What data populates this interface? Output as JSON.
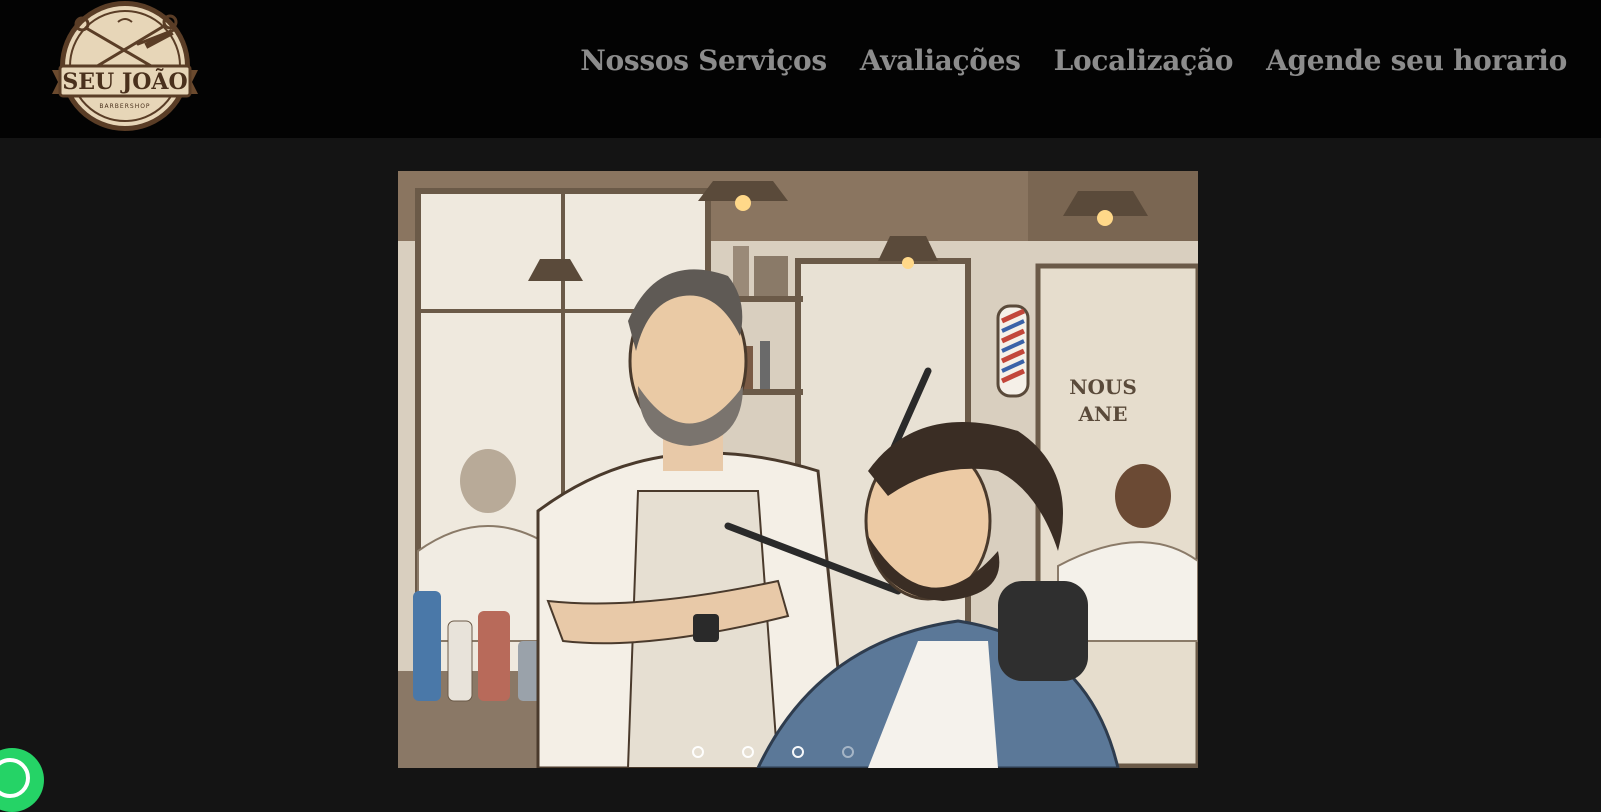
{
  "brand": {
    "name_line1": "SEU JOÃO",
    "name_line2": "BARBERSHOP",
    "colors": {
      "badge_outer": "#5a3d26",
      "badge_inner": "#e7d6b8",
      "banner": "#6b4a2e"
    }
  },
  "nav": {
    "items": [
      {
        "label": "Nossos Serviços"
      },
      {
        "label": "Avaliações"
      },
      {
        "label": "Localização"
      },
      {
        "label": "Agende seu horario"
      }
    ],
    "color": "#8c8c8c"
  },
  "carousel": {
    "slide_count": 4,
    "active_index": 0,
    "slide_alt": "Ilustração de barbeiro fazendo a barba de um cliente",
    "shop_window_text": {
      "line1": "NOUS",
      "line2": "ANE"
    }
  },
  "floating": {
    "icon": "whatsapp-icon",
    "color": "#25d366"
  }
}
